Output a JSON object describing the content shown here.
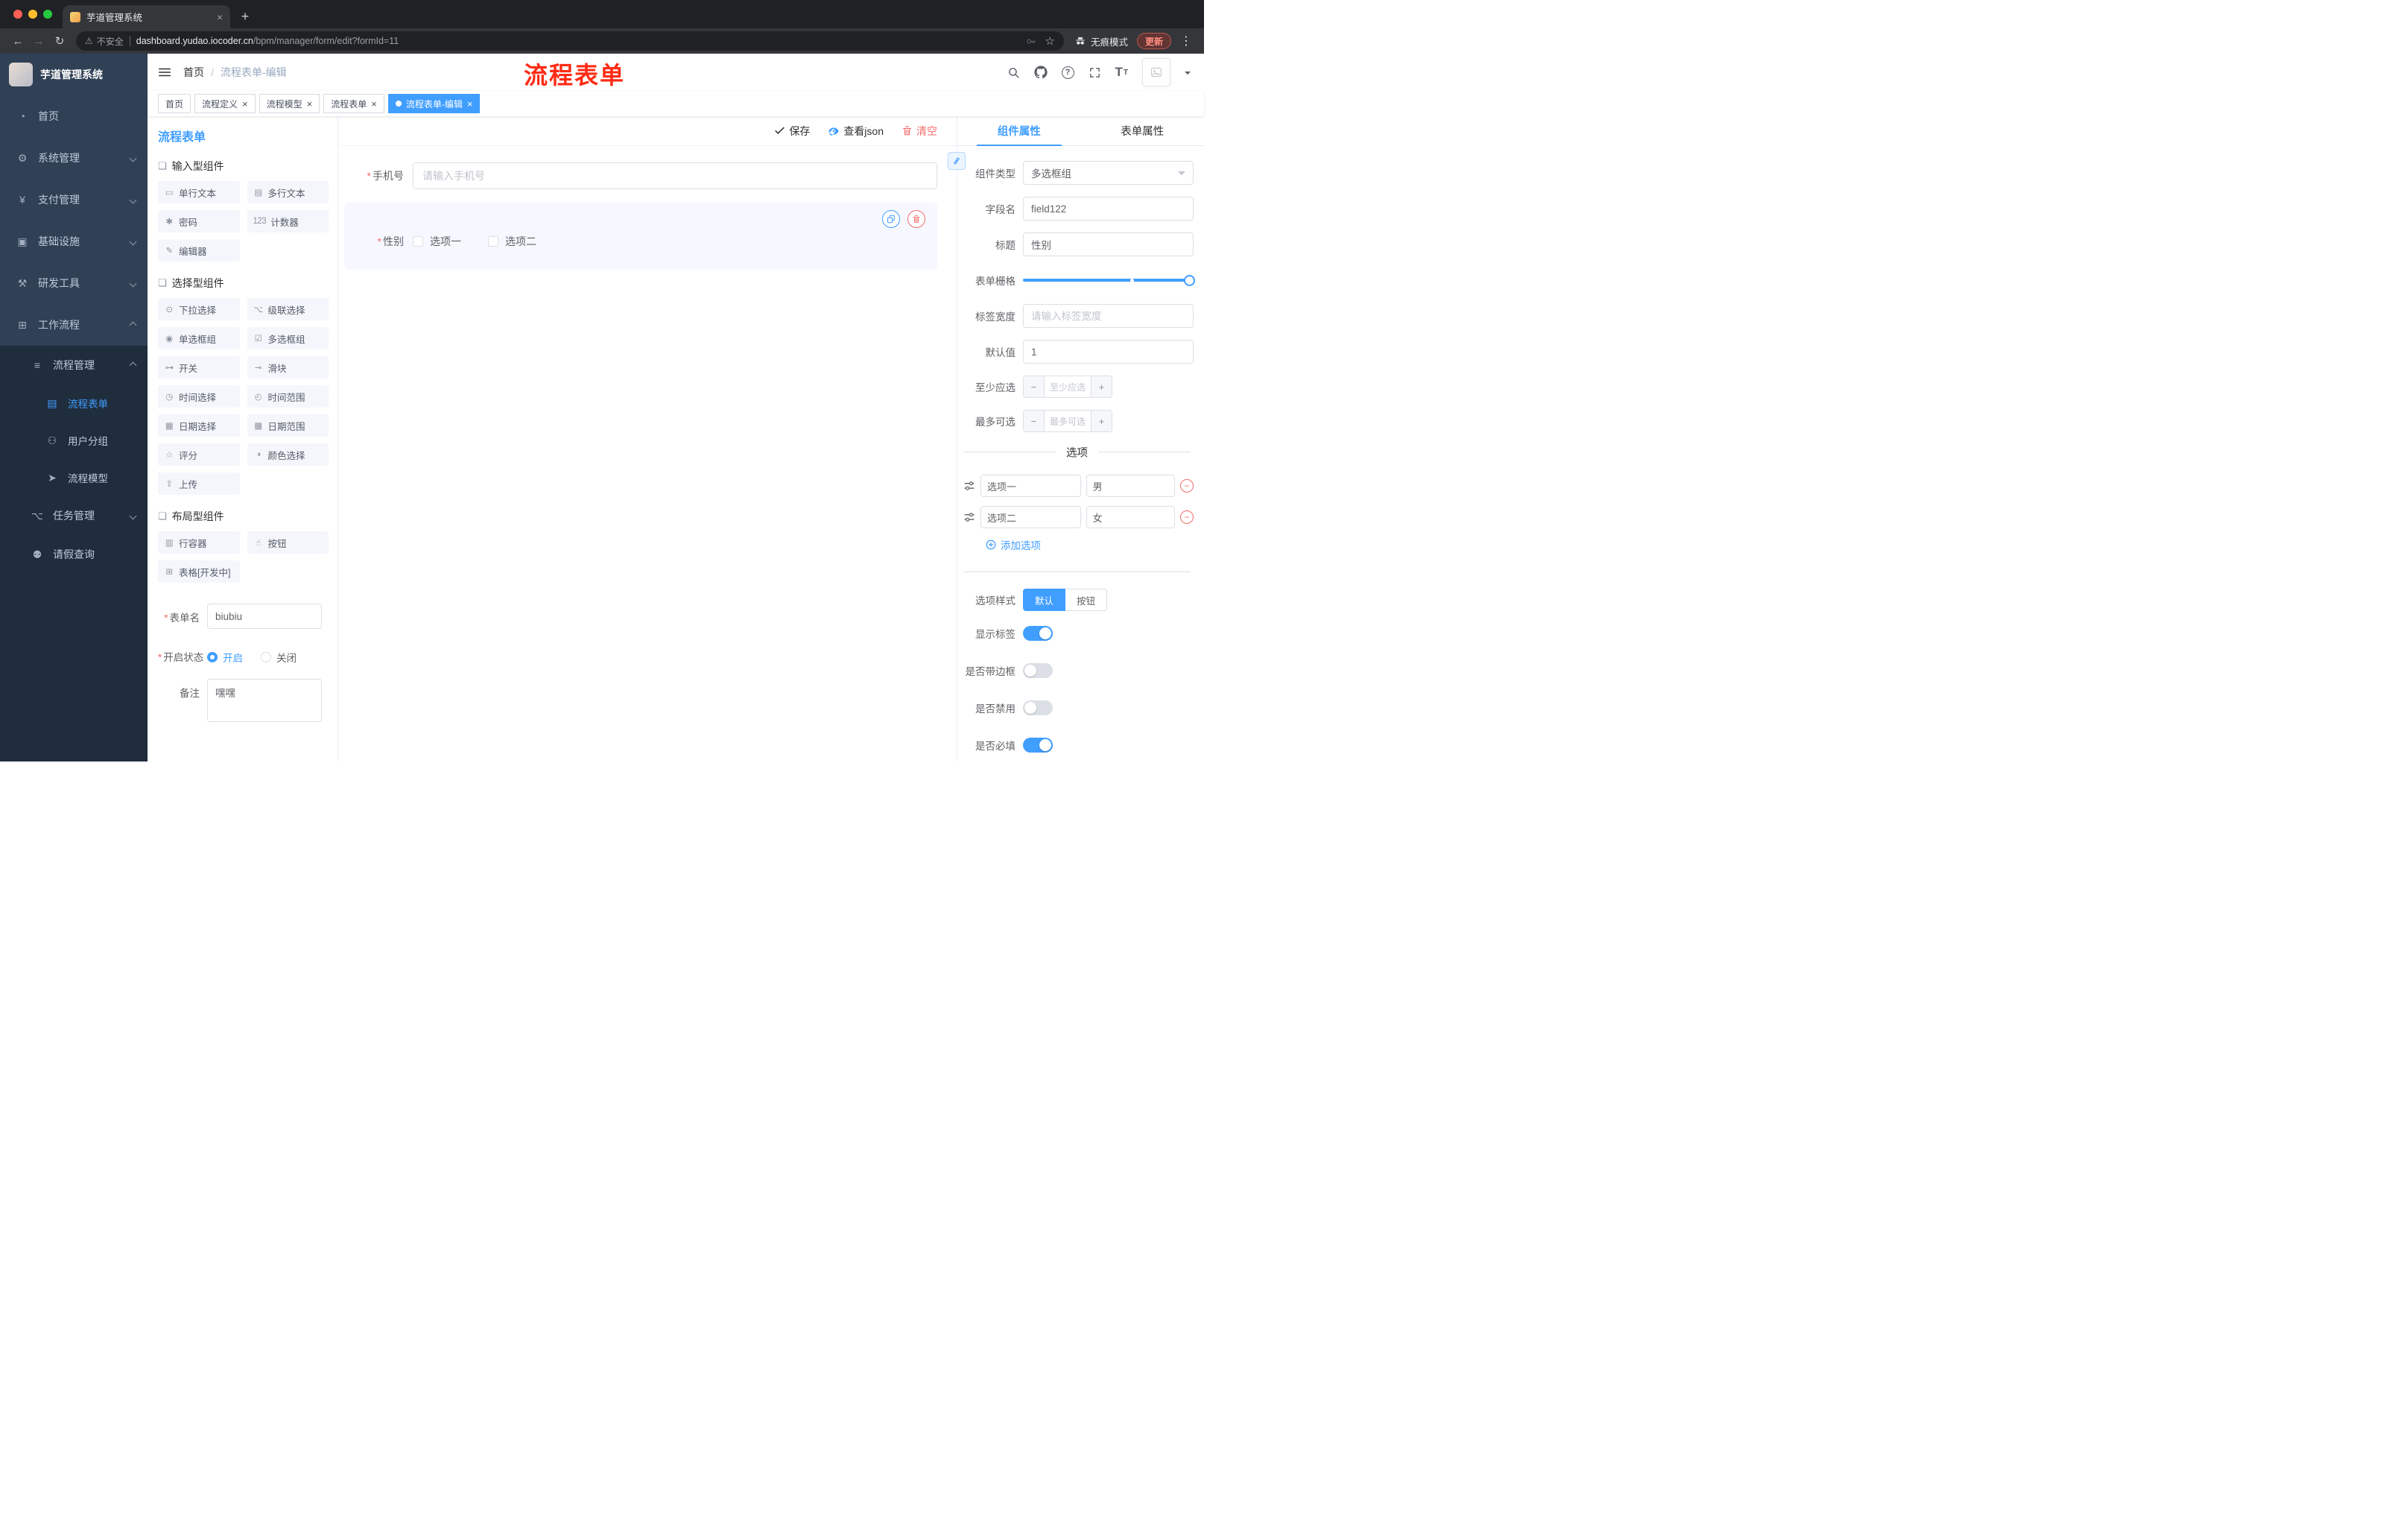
{
  "ui": {
    "asterisk": "*",
    "minus": "−",
    "plus": "+",
    "close": "×",
    "dots": "⋮",
    "back": "←",
    "forward": "→",
    "reload": "↻",
    "star": "☆",
    "warning": "⚠",
    "question": "?",
    "font_icon": "T",
    "breadcrumb_sep": "/"
  },
  "browser": {
    "tab_title": "芋道管理系统",
    "new_tab_button": "+",
    "security_label": "不安全",
    "url_host": "dashboard.yudao.iocoder.cn",
    "url_path": "/bpm/manager/form/edit?formId=11",
    "incognito_label": "无痕模式",
    "update_label": "更新"
  },
  "sidebar": {
    "logo_title": "芋道管理系统",
    "items": [
      {
        "label": "首页",
        "icon": "◔"
      },
      {
        "label": "系统管理",
        "icon": "⚙"
      },
      {
        "label": "支付管理",
        "icon": "¥"
      },
      {
        "label": "基础设施",
        "icon": "▣"
      },
      {
        "label": "研发工具",
        "icon": "⚒"
      },
      {
        "label": "工作流程",
        "icon": "⊞"
      },
      {
        "label": "流程管理",
        "icon": "≡"
      },
      {
        "label": "流程表单",
        "icon": "▤"
      },
      {
        "label": "用户分组",
        "icon": "⚇"
      },
      {
        "label": "流程模型",
        "icon": "➤"
      },
      {
        "label": "任务管理",
        "icon": "⌥"
      },
      {
        "label": "请假查询",
        "icon": "⚉"
      }
    ]
  },
  "header": {
    "breadcrumb_home": "首页",
    "breadcrumb_current": "流程表单-编辑",
    "annotation": "流程表单"
  },
  "tags": [
    {
      "label": "首页"
    },
    {
      "label": "流程定义"
    },
    {
      "label": "流程模型"
    },
    {
      "label": "流程表单"
    },
    {
      "label": "流程表单-编辑"
    }
  ],
  "designer": {
    "title": "流程表单",
    "save_label": "保存",
    "view_json_label": "查看json",
    "clear_label": "清空",
    "groups": [
      {
        "title": "输入型组件",
        "items": [
          {
            "label": "单行文本",
            "icon": "▭"
          },
          {
            "label": "多行文本",
            "icon": "▤"
          },
          {
            "label": "密码",
            "icon": "✱"
          },
          {
            "label": "计数器",
            "icon": "123"
          },
          {
            "label": "编辑器",
            "icon": "✎"
          }
        ]
      },
      {
        "title": "选择型组件",
        "items": [
          {
            "label": "下拉选择",
            "icon": "⊙"
          },
          {
            "label": "级联选择",
            "icon": "⌥"
          },
          {
            "label": "单选框组",
            "icon": "◉"
          },
          {
            "label": "多选框组",
            "icon": "☑"
          },
          {
            "label": "开关",
            "icon": "⊶"
          },
          {
            "label": "滑块",
            "icon": "⊸"
          },
          {
            "label": "时间选择",
            "icon": "◷"
          },
          {
            "label": "时间范围",
            "icon": "◴"
          },
          {
            "label": "日期选择",
            "icon": "▦"
          },
          {
            "label": "日期范围",
            "icon": "▩"
          },
          {
            "label": "评分",
            "icon": "☆"
          },
          {
            "label": "颜色选择",
            "icon": "◑"
          },
          {
            "label": "上传",
            "icon": "⇪"
          }
        ]
      },
      {
        "title": "布局型组件",
        "items": [
          {
            "label": "行容器",
            "icon": "▥"
          },
          {
            "label": "按钮",
            "icon": "☝"
          },
          {
            "label": "表格[开发中]",
            "icon": "⊞"
          }
        ]
      }
    ],
    "meta": {
      "name_label": "表单名",
      "name_value": "biubiu",
      "status_label": "开启状态",
      "status_on": "开启",
      "status_off": "关闭",
      "remark_label": "备注",
      "remark_value": "嘿嘿"
    },
    "canvas": {
      "phone_label": "手机号",
      "phone_placeholder": "请输入手机号",
      "gender_label": "性别",
      "gender_option1": "选项一",
      "gender_option2": "选项二"
    }
  },
  "panel": {
    "tab_component": "组件属性",
    "tab_form": "表单属性",
    "component_type_label": "组件类型",
    "component_type_value": "多选框组",
    "field_name_label": "字段名",
    "field_name_value": "field122",
    "title_label": "标题",
    "title_value": "性别",
    "grid_label": "表单栅格",
    "label_width_label": "标签宽度",
    "label_width_placeholder": "请输入标签宽度",
    "default_label": "默认值",
    "default_value": "1",
    "min_label": "至少应选",
    "min_placeholder": "至少应选",
    "max_label": "最多可选",
    "max_placeholder": "最多可选",
    "options_title": "选项",
    "options": [
      {
        "name": "选项一",
        "value": "男"
      },
      {
        "name": "选项二",
        "value": "女"
      }
    ],
    "add_option_label": "添加选项",
    "style_label": "选项样式",
    "style_default": "默认",
    "style_button": "按钮",
    "switch_show_label": "显示标签",
    "switch_border": "是否带边框",
    "switch_disabled": "是否禁用",
    "switch_required": "是否必填"
  },
  "colors": {
    "primary": "#409eff",
    "danger": "#f56c6c"
  }
}
